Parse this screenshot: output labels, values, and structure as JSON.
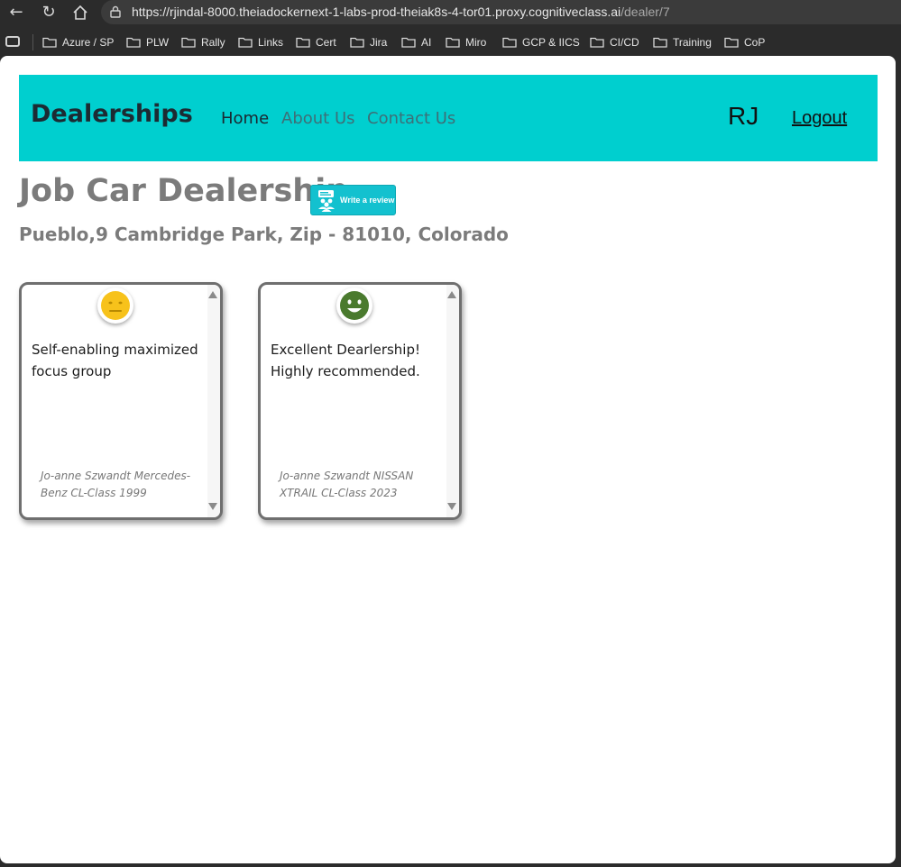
{
  "browser": {
    "url_host": "https://rjindal-8000.theiadockernext-1-labs-prod-theiak8s-4-tor01.proxy.cognitiveclass.ai",
    "url_path": "/dealer/7",
    "bookmarks": [
      {
        "label": "Azure / SP"
      },
      {
        "label": "PLW"
      },
      {
        "label": "Rally"
      },
      {
        "label": "Links"
      },
      {
        "label": "Cert"
      },
      {
        "label": "Jira"
      },
      {
        "label": "AI"
      },
      {
        "label": "Miro"
      },
      {
        "label": "GCP & IICS"
      },
      {
        "label": "CI/CD"
      },
      {
        "label": "Training"
      },
      {
        "label": "CoP"
      }
    ]
  },
  "navbar": {
    "brand": "Dealerships",
    "links": {
      "home": "Home",
      "about": "About Us",
      "contact": "Contact Us"
    },
    "user_initials": "RJ",
    "logout": "Logout",
    "color": "#00cfcf"
  },
  "dealer": {
    "name": "Job Car Dealership",
    "review_button": "Write a review",
    "address": "Pueblo,9 Cambridge Park, Zip - 81010, Colorado"
  },
  "reviews": [
    {
      "sentiment": "neutral",
      "icon": "neutral-face-icon",
      "text": "Self-enabling maximized focus group",
      "reviewer": "Jo-anne Szwandt Mercedes-Benz CL-Class 1999",
      "color": "#f7c21b"
    },
    {
      "sentiment": "positive",
      "icon": "smiling-face-icon",
      "text": "Excellent Dearlership! Highly recommended.",
      "reviewer": "Jo-anne Szwandt NISSAN XTRAIL CL-Class 2023",
      "color": "#4a7a2e"
    }
  ]
}
